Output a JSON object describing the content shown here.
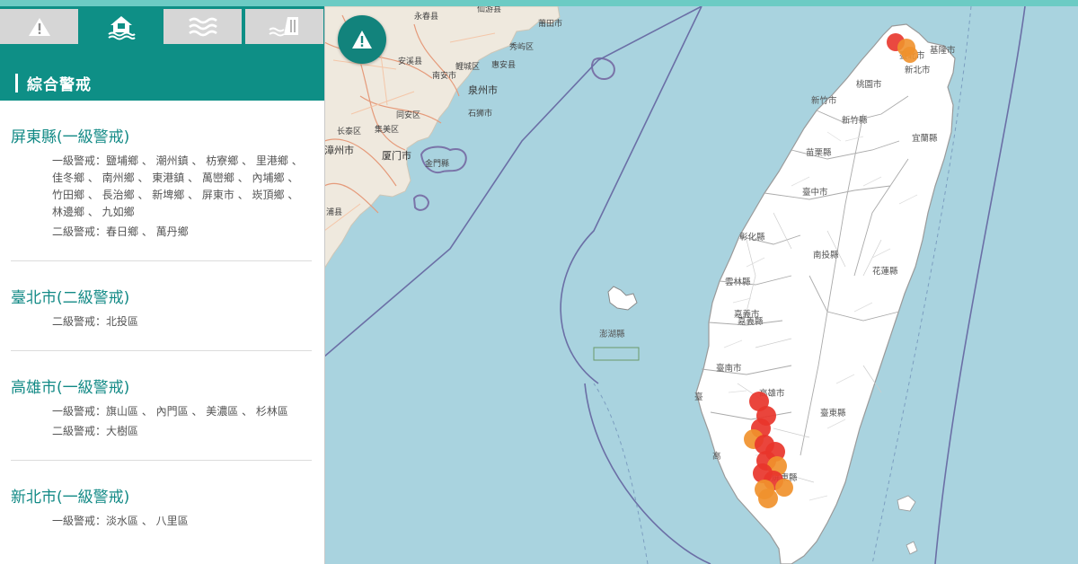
{
  "tabs": [
    {
      "icon": "warning-triangle-icon",
      "active": false
    },
    {
      "icon": "flood-house-icon",
      "active": true
    },
    {
      "icon": "water-waves-icon",
      "active": false
    },
    {
      "icon": "dam-icon",
      "active": false
    }
  ],
  "header": {
    "title": "綜合警戒"
  },
  "counties": [
    {
      "name": "屏東縣(一級警戒)",
      "levels": [
        {
          "label": "一級警戒：",
          "areas": "鹽埔鄉 、 潮州鎮 、 枋寮鄉 、 里港鄉 、 佳冬鄉 、 南州鄉 、 東港鎮 、 萬巒鄉 、 內埔鄉 、 竹田鄉 、 長治鄉 、 新埤鄉 、 屏東市 、 崁頂鄉 、 林邊鄉 、 九如鄉"
        },
        {
          "label": "二級警戒：",
          "areas": "春日鄉 、 萬丹鄉"
        }
      ]
    },
    {
      "name": "臺北市(二級警戒)",
      "levels": [
        {
          "label": "二級警戒：",
          "areas": "北投區"
        }
      ]
    },
    {
      "name": "高雄市(一級警戒)",
      "levels": [
        {
          "label": "一級警戒：",
          "areas": "旗山區 、 內門區 、 美濃區 、 杉林區"
        },
        {
          "label": "二級警戒：",
          "areas": "大樹區"
        }
      ]
    },
    {
      "name": "新北市(一級警戒)",
      "levels": [
        {
          "label": "一級警戒：",
          "areas": "淡水區 、 八里區"
        }
      ]
    }
  ],
  "map": {
    "warning_button_icon": "warning-triangle-icon",
    "colors": {
      "sea": "#a9d3df",
      "land": "#ffffff",
      "mainland": "#efe9de",
      "level1": "#e8352b",
      "level2": "#f0912c",
      "accent": "#0e8f86"
    },
    "labels": {
      "yongchun": "永春县",
      "xianyou": "仙游县",
      "putian": "莆田市",
      "xiuyu": "秀屿区",
      "nanan": "南安市",
      "anxi": "安溪县",
      "licheng": "鲤城区",
      "huian": "惠安县",
      "quanzhou": "泉州市",
      "shishi": "石狮市",
      "tongan": "同安区",
      "changtai": "长泰区",
      "jimei": "集美区",
      "xiamen": "厦门市",
      "jinmen": "金門縣",
      "zhangzhou": "漳州市",
      "pu": "浦县",
      "keelung": "基隆市",
      "taipei": "臺北市",
      "newtaipei": "新北市",
      "taoyuan": "桃園市",
      "hsinchu_city": "新竹市",
      "hsinchu": "新竹縣",
      "yilan": "宜蘭縣",
      "miaoli": "苗栗縣",
      "taichung": "臺中市",
      "changhua": "彰化縣",
      "nantou": "南投縣",
      "hualien": "花蓮縣",
      "yunlin": "雲林縣",
      "chiayi_city": "嘉義市",
      "chiayi": "嘉義縣",
      "penghu": "澎湖縣",
      "tainan": "臺南市",
      "kaohsiung_lbl": "高雄市",
      "taitung": "臺東縣",
      "pingtung": "屏東縣",
      "tai_short": "臺",
      "gao_short": "高"
    }
  }
}
